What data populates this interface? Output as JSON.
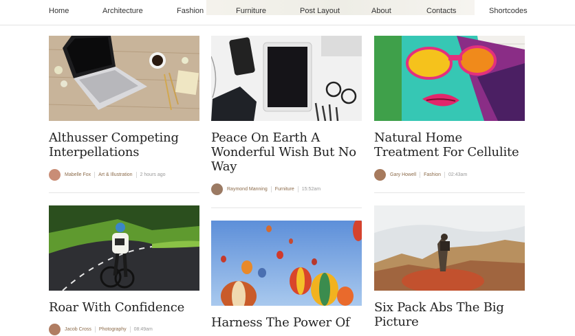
{
  "nav": [
    "Home",
    "Architecture",
    "Fashion",
    "Furniture",
    "Post Layout",
    "About",
    "Contacts",
    "Shortcodes"
  ],
  "posts": [
    {
      "title": "Althusser Competing Interpellations",
      "author": "Mabelle Fox",
      "category": "Art & Illustration",
      "time": "2 hours ago"
    },
    {
      "title": "Peace On Earth A Wonderful Wish But No Way",
      "author": "Raymond Manning",
      "category": "Furniture",
      "time": "15:52am"
    },
    {
      "title": "Natural Home Treatment For Cellulite",
      "author": "Gary Howell",
      "category": "Fashion",
      "time": "02:43am"
    },
    {
      "title": "Roar With Confidence",
      "author": "Jacob Cross",
      "category": "Photography",
      "time": "08:49am"
    },
    {
      "title": "Harness The Power Of",
      "author": "",
      "category": "",
      "time": ""
    },
    {
      "title": "Six Pack Abs The Big Picture",
      "author": "",
      "category": "",
      "time": ""
    }
  ],
  "colors": {
    "meta": "#8b6a49",
    "title": "#222222",
    "rule": "#e5e5e5"
  }
}
